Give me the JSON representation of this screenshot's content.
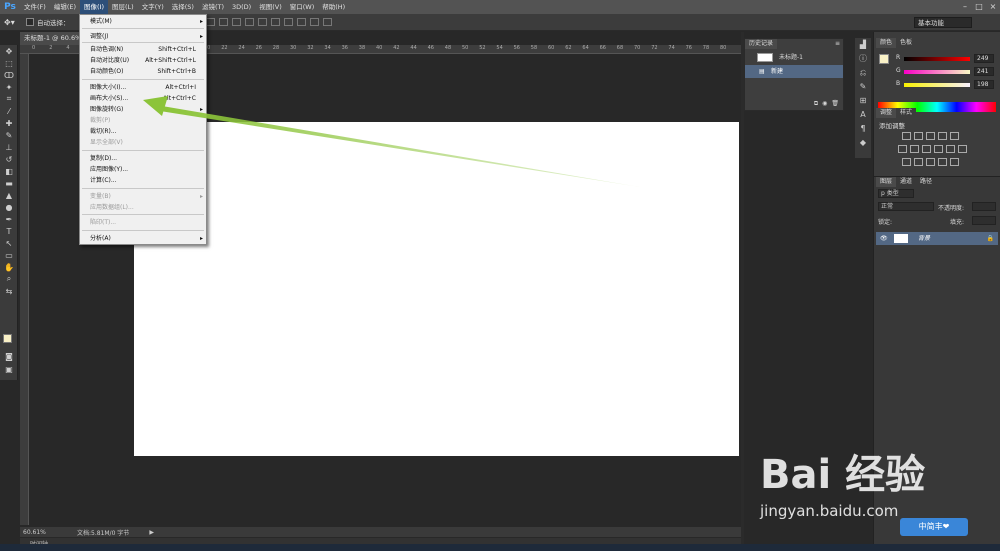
{
  "app": {
    "logo": "Ps"
  },
  "menubar": {
    "items": [
      "文件(F)",
      "编辑(E)",
      "图像(I)",
      "图层(L)",
      "文字(Y)",
      "选择(S)",
      "滤镜(T)",
      "3D(D)",
      "视图(V)",
      "窗口(W)",
      "帮助(H)"
    ],
    "active": "图像(I)"
  },
  "optionsbar": {
    "auto_select_label": "自动选择：",
    "workspace": "基本功能"
  },
  "document": {
    "tab_title": "未标题-1 @ 60.6%",
    "ruler_ticks": [
      "0",
      "2",
      "4",
      "6",
      "8",
      "10",
      "12",
      "14",
      "16",
      "18",
      "20",
      "22",
      "24",
      "26",
      "28",
      "30",
      "32",
      "34",
      "36",
      "38",
      "40",
      "42",
      "44",
      "46",
      "48",
      "50",
      "52",
      "54",
      "56",
      "58",
      "60",
      "62",
      "64",
      "66",
      "68",
      "70",
      "72",
      "74",
      "76",
      "78",
      "80"
    ],
    "zoom": "60.61%",
    "doc_info": "文档:5.81M/0 字节",
    "timeline_label": "时间轴"
  },
  "image_menu": {
    "items": [
      {
        "label": "模式(M)",
        "shortcut": "",
        "submenu": true,
        "disabled": false
      },
      {
        "label": "调整(J)",
        "shortcut": "",
        "submenu": true,
        "disabled": false
      },
      {
        "label": "自动色调(N)",
        "shortcut": "Shift+Ctrl+L",
        "submenu": false,
        "disabled": false
      },
      {
        "label": "自动对比度(U)",
        "shortcut": "Alt+Shift+Ctrl+L",
        "submenu": false,
        "disabled": false
      },
      {
        "label": "自动颜色(O)",
        "shortcut": "Shift+Ctrl+B",
        "submenu": false,
        "disabled": false
      },
      {
        "label": "图像大小(I)...",
        "shortcut": "Alt+Ctrl+I",
        "submenu": false,
        "disabled": false
      },
      {
        "label": "画布大小(S)...",
        "shortcut": "Alt+Ctrl+C",
        "submenu": false,
        "disabled": false
      },
      {
        "label": "图像旋转(G)",
        "shortcut": "",
        "submenu": true,
        "disabled": false
      },
      {
        "label": "裁剪(P)",
        "shortcut": "",
        "submenu": false,
        "disabled": true
      },
      {
        "label": "裁切(R)...",
        "shortcut": "",
        "submenu": false,
        "disabled": false
      },
      {
        "label": "显示全部(V)",
        "shortcut": "",
        "submenu": false,
        "disabled": true
      },
      {
        "label": "复制(D)...",
        "shortcut": "",
        "submenu": false,
        "disabled": false
      },
      {
        "label": "应用图像(Y)...",
        "shortcut": "",
        "submenu": false,
        "disabled": false
      },
      {
        "label": "计算(C)...",
        "shortcut": "",
        "submenu": false,
        "disabled": false
      },
      {
        "label": "变量(B)",
        "shortcut": "",
        "submenu": true,
        "disabled": true
      },
      {
        "label": "应用数据组(L)...",
        "shortcut": "",
        "submenu": false,
        "disabled": true
      },
      {
        "label": "陷印(T)...",
        "shortcut": "",
        "submenu": false,
        "disabled": true
      },
      {
        "label": "分析(A)",
        "shortcut": "",
        "submenu": true,
        "disabled": false
      }
    ]
  },
  "history": {
    "tab": "历史记录",
    "snapshot": "未标题-1",
    "state": "新建"
  },
  "color_panel": {
    "tabs": [
      "颜色",
      "色板"
    ],
    "r": "249",
    "g": "241",
    "b": "198",
    "r_label": "R",
    "g_label": "G",
    "b_label": "B"
  },
  "adjust_panel": {
    "tabs": [
      "调整",
      "样式"
    ],
    "title": "添加调整"
  },
  "layers_panel": {
    "tabs": [
      "图层",
      "通道",
      "路径"
    ],
    "kind": "p 类型",
    "blend": "正常",
    "opacity_label": "不透明度:",
    "lock_label": "锁定:",
    "fill_label": "填充:",
    "layer_name": "背景"
  },
  "watermark": {
    "brand": "Bai 经验",
    "url": "jingyan.baidu.com",
    "badge": "中简丰❤"
  },
  "colors": {
    "accent": "#536884",
    "arrow": "#8cc43a",
    "menu_active": "#2d4f79",
    "foreground": "#f9f1c6"
  }
}
